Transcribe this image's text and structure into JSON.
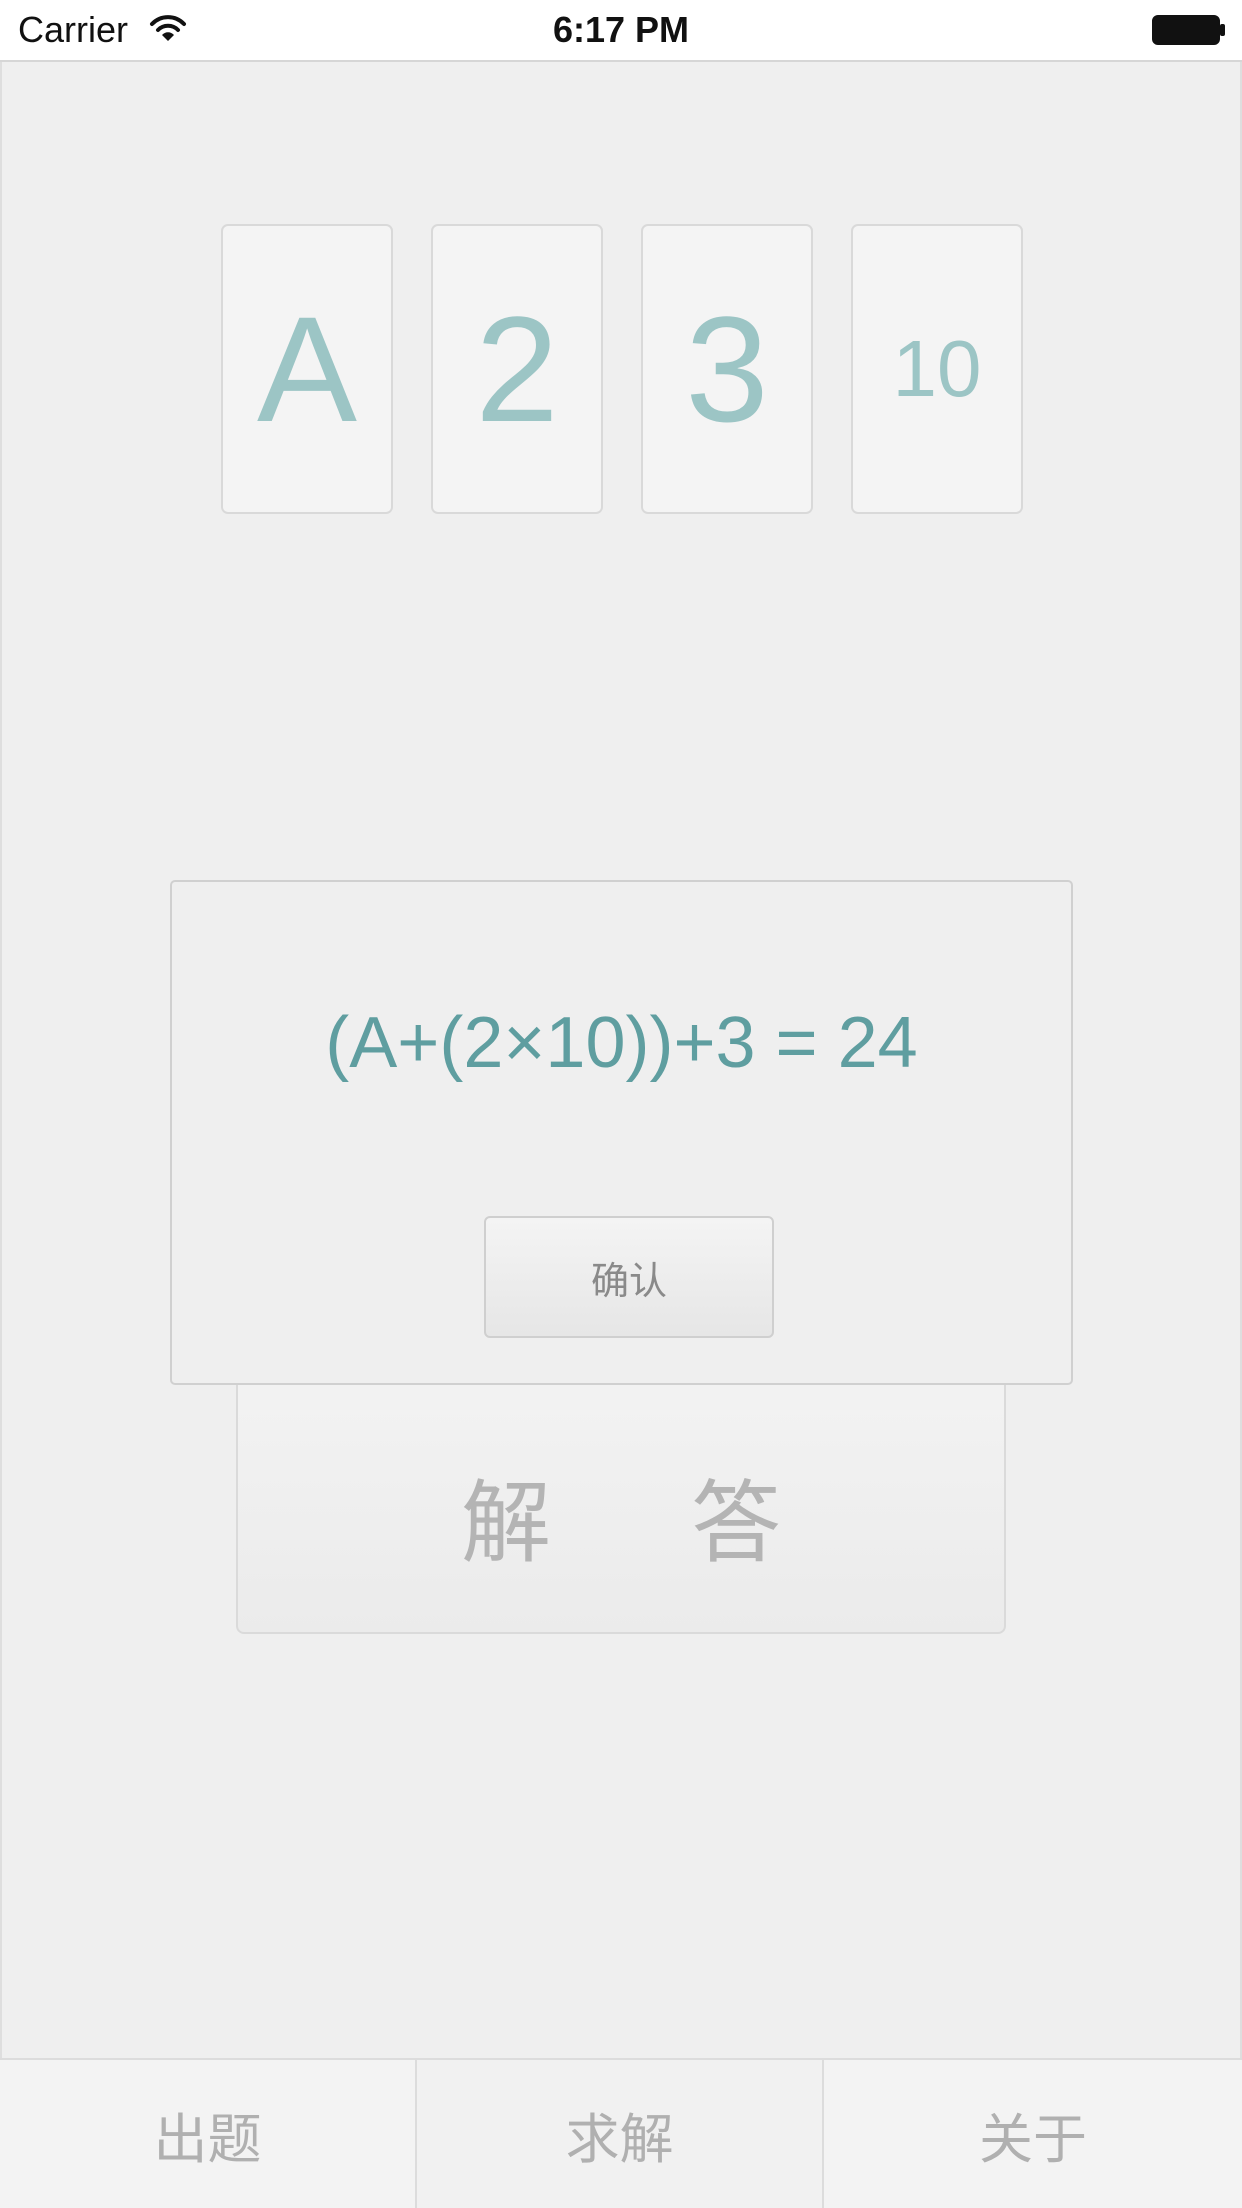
{
  "status_bar": {
    "carrier": "Carrier",
    "time": "6:17 PM"
  },
  "cards": [
    {
      "value": "A"
    },
    {
      "value": "2"
    },
    {
      "value": "3"
    },
    {
      "value": "10"
    }
  ],
  "answer_button": {
    "label": "解答"
  },
  "result_dialog": {
    "solution": "(A+(2×10))+3 = 24",
    "confirm_label": "确认"
  },
  "tab_bar": {
    "selected_index": 1,
    "tabs": [
      {
        "label": "出题"
      },
      {
        "label": "求解"
      },
      {
        "label": "关于"
      }
    ]
  },
  "colors": {
    "card_text": "#9cc5c5",
    "solution_text": "#5f9ea0",
    "background": "#efefef"
  }
}
